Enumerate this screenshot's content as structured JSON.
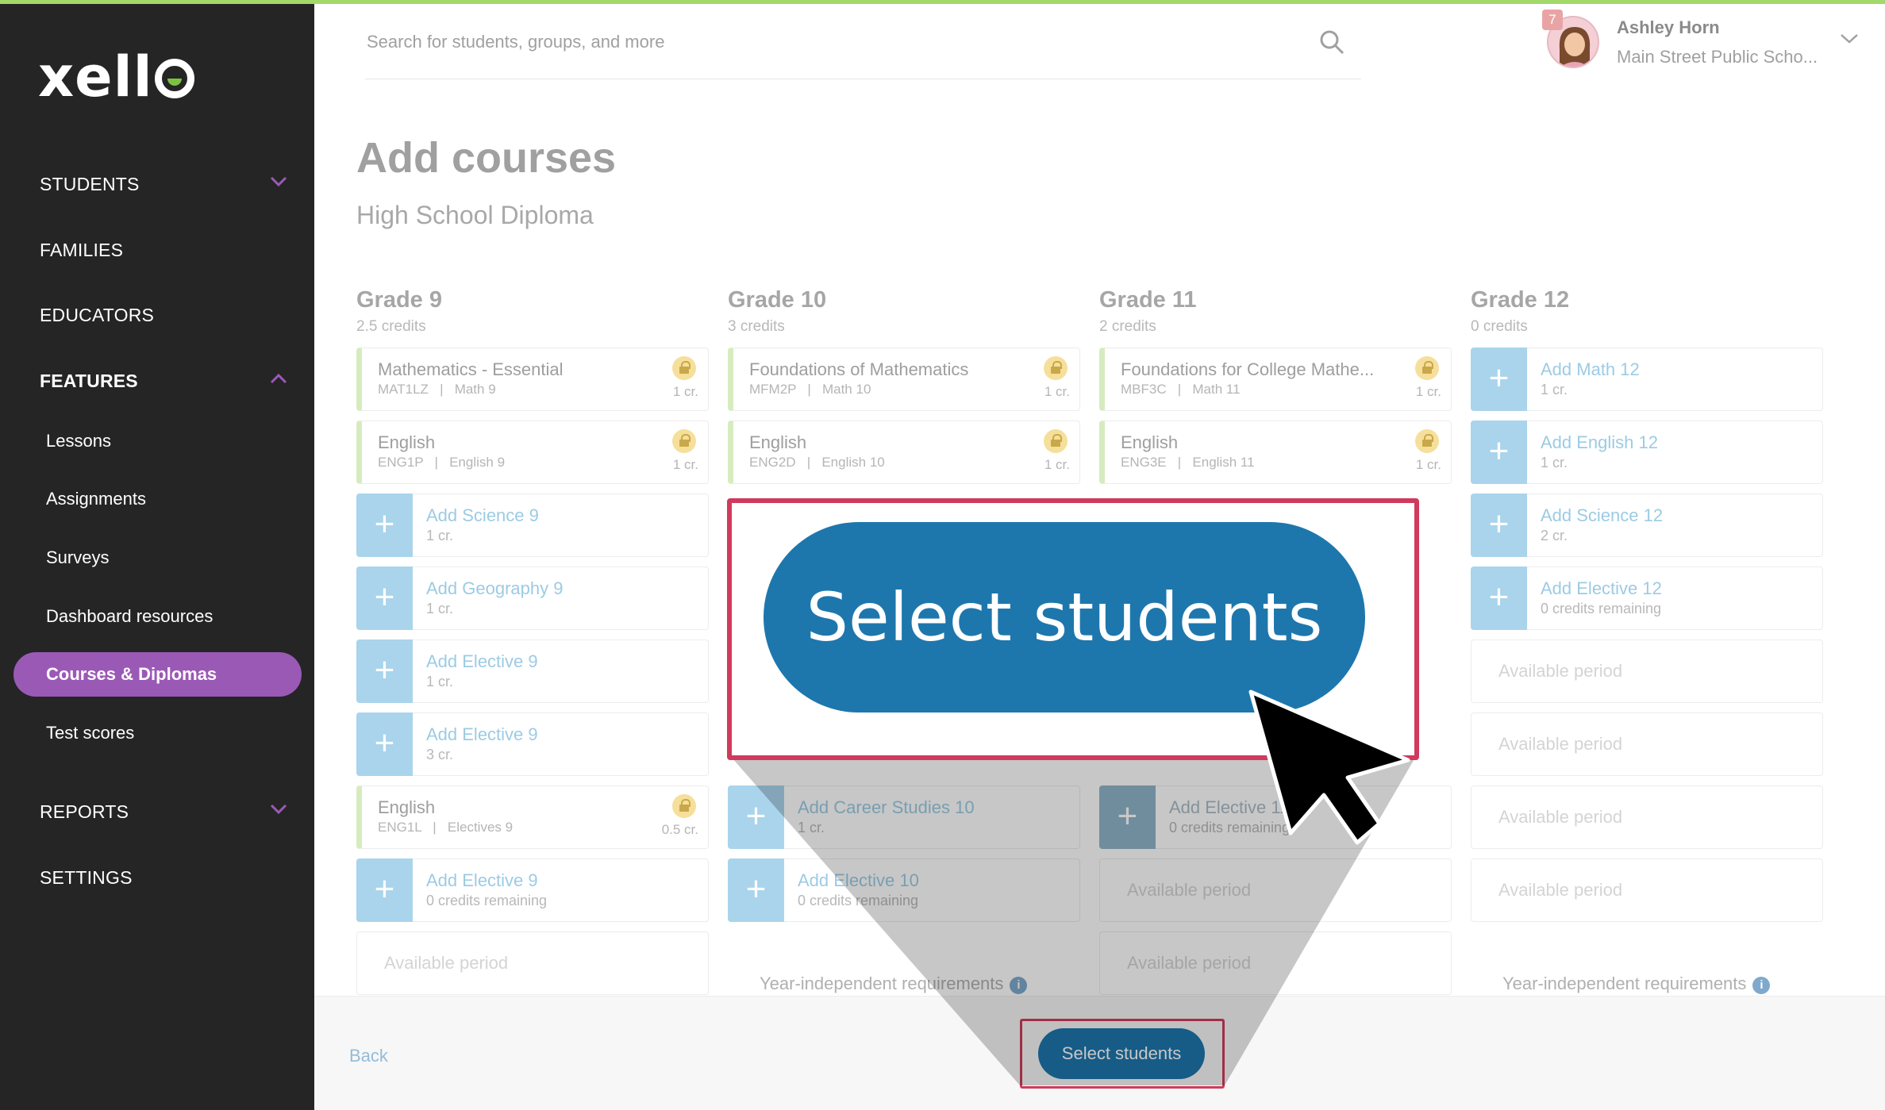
{
  "brand": {
    "logo_text": "xell",
    "accent": "#7dc142"
  },
  "sidebar": {
    "students": "STUDENTS",
    "families": "FAMILIES",
    "educators": "EDUCATORS",
    "features": "FEATURES",
    "feature_items": [
      "Lessons",
      "Assignments",
      "Surveys",
      "Dashboard resources",
      "Courses & Diplomas",
      "Test scores"
    ],
    "reports": "REPORTS",
    "settings": "SETTINGS",
    "active_color": "#9b59b6"
  },
  "header": {
    "search_placeholder": "Search for students, groups, and more",
    "notification_count": "7",
    "user_name": "Ashley Horn",
    "user_school": "Main Street Public Scho..."
  },
  "page": {
    "title": "Add courses",
    "subtitle": "High School Diploma"
  },
  "grades": [
    {
      "title": "Grade 9",
      "credits": "2.5 credits",
      "cards": [
        {
          "type": "course",
          "title": "Mathematics - Essential",
          "code": "MAT1LZ",
          "group": "Math 9",
          "credit": "1 cr."
        },
        {
          "type": "course",
          "title": "English",
          "code": "ENG1P",
          "group": "English 9",
          "credit": "1 cr."
        },
        {
          "type": "add",
          "title": "Add Science 9",
          "meta": "1 cr."
        },
        {
          "type": "add",
          "title": "Add Geography 9",
          "meta": "1 cr."
        },
        {
          "type": "add",
          "title": "Add Elective 9",
          "meta": "1 cr."
        },
        {
          "type": "add",
          "title": "Add Elective 9",
          "meta": "3 cr."
        },
        {
          "type": "course",
          "title": "English",
          "code": "ENG1L",
          "group": "Electives 9",
          "credit": "0.5 cr."
        },
        {
          "type": "add",
          "title": "Add Elective 9",
          "meta": "0 credits remaining"
        },
        {
          "type": "avail",
          "title": "Available period"
        }
      ]
    },
    {
      "title": "Grade 10",
      "credits": "3 credits",
      "cards": [
        {
          "type": "course",
          "title": "Foundations of Mathematics",
          "code": "MFM2P",
          "group": "Math 10",
          "credit": "1 cr."
        },
        {
          "type": "course",
          "title": "English",
          "code": "ENG2D",
          "group": "English 10",
          "credit": "1 cr."
        },
        {
          "type": "add",
          "title": "Add Career Studies 10",
          "meta": "1 cr."
        },
        {
          "type": "add",
          "title": "Add Elective 10",
          "meta": "0 credits remaining"
        }
      ],
      "year_independent": "Year-independent requirements"
    },
    {
      "title": "Grade 11",
      "credits": "2 credits",
      "cards": [
        {
          "type": "course",
          "title": "Foundations for College Mathe...",
          "code": "MBF3C",
          "group": "Math 11",
          "credit": "1 cr."
        },
        {
          "type": "course",
          "title": "English",
          "code": "ENG3E",
          "group": "English 11",
          "credit": "1 cr."
        },
        {
          "type": "add",
          "title": "Add Elective 11",
          "meta": "0 credits remaining"
        },
        {
          "type": "avail",
          "title": "Available period"
        },
        {
          "type": "avail",
          "title": "Available period"
        }
      ]
    },
    {
      "title": "Grade 12",
      "credits": "0 credits",
      "cards": [
        {
          "type": "add",
          "title": "Add Math 12",
          "meta": "1 cr."
        },
        {
          "type": "add",
          "title": "Add English 12",
          "meta": "1 cr."
        },
        {
          "type": "add",
          "title": "Add Science 12",
          "meta": "2 cr."
        },
        {
          "type": "add",
          "title": "Add Elective 12",
          "meta": "0 credits remaining"
        },
        {
          "type": "avail",
          "title": "Available period"
        },
        {
          "type": "avail",
          "title": "Available period"
        },
        {
          "type": "avail",
          "title": "Available period"
        },
        {
          "type": "avail",
          "title": "Available period"
        }
      ],
      "year_independent": "Year-independent requirements"
    }
  ],
  "footer": {
    "back": "Back",
    "select_students": "Select students"
  },
  "callout": {
    "label": "Select students",
    "button_color": "#1d77ad",
    "frame_color": "#d03a5c"
  }
}
